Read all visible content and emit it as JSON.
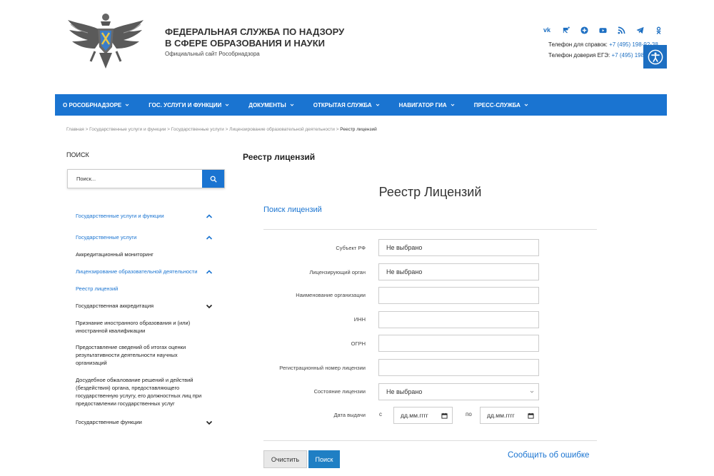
{
  "header": {
    "title": "ФЕДЕРАЛЬНАЯ СЛУЖБА ПО НАДЗОРУ В СФЕРЕ ОБРАЗОВАНИЯ И НАУКИ",
    "subtitle": "Официальный сайт Рособрнадзора",
    "phone_label": "Телефон для справок:",
    "phone_value": "+7 (495) 198-92-38",
    "trust_label": "Телефон доверия ЕГЭ:",
    "trust_value": "+7 (495) 198-9",
    "socials": [
      "vk-icon",
      "rutube-icon",
      "ok-plus-icon",
      "youtube-icon",
      "rss-icon",
      "telegram-icon",
      "odnoklassniki-icon"
    ],
    "socials_vk_text": "vk",
    "accent": "#1a74d1"
  },
  "nav": {
    "items": [
      "О РОСОБРНАДЗОРЕ",
      "ГОС. УСЛУГИ И ФУНКЦИИ",
      "ДОКУМЕНТЫ",
      "ОТКРЫТАЯ СЛУЖБА",
      "НАВИГАТОР ГИА",
      "ПРЕСС-СЛУЖБА"
    ]
  },
  "breadcrumb": {
    "items": [
      "Главная",
      "Государственные услуги и функции",
      "Государственные услуги",
      "Лицензирование образовательной деятельности"
    ],
    "separator": ">",
    "current": "Реестр лицензий"
  },
  "sidebar": {
    "title": "ПОИСК",
    "search_placeholder": "Поиск...",
    "items": [
      {
        "label": "Государственные услуги и функции"
      },
      {
        "label": "Государственные услуги"
      },
      {
        "label": "Аккредитационный мониторинг"
      },
      {
        "label": "Лицензирование образовательной деятельности"
      },
      {
        "label": "Реестр лицензий"
      },
      {
        "label": "Государственная аккредитация"
      },
      {
        "label": "Признание иностранного образования и (или) иностранной квалификации"
      },
      {
        "label": "Предоставление сведений об итогах оценки результативности деятельности научных организаций"
      },
      {
        "label": "Досудебное обжалование решений и действий (бездействия) органа, предоставляющего государственную услугу, его должностных лиц при предоставлении государственных услуг"
      },
      {
        "label": "Государственные функции"
      }
    ]
  },
  "main": {
    "heading": "Реестр лицензий",
    "form_title": "Реестр Лицензий",
    "search_link": "Поиск лицензий",
    "fields": [
      {
        "label": "Субъект РФ",
        "value": "Не выбрано"
      },
      {
        "label": "Лицензирующий орган",
        "value": "Не выбрано"
      },
      {
        "label": "Наименование организации",
        "value": ""
      },
      {
        "label": "ИНН",
        "value": ""
      },
      {
        "label": "ОГРН",
        "value": ""
      },
      {
        "label": "Регистрационный номер лицензии",
        "value": ""
      },
      {
        "label": "Состояние лицензии",
        "value": "Не выбрано"
      }
    ],
    "date": {
      "label": "Дата выдачи",
      "from_label": "с",
      "to_label": "по",
      "placeholder": "дд.мм.гггг"
    },
    "clear_button": "Очистить",
    "search_button": "Поиск",
    "report_link": "Сообщить об ошибке"
  }
}
